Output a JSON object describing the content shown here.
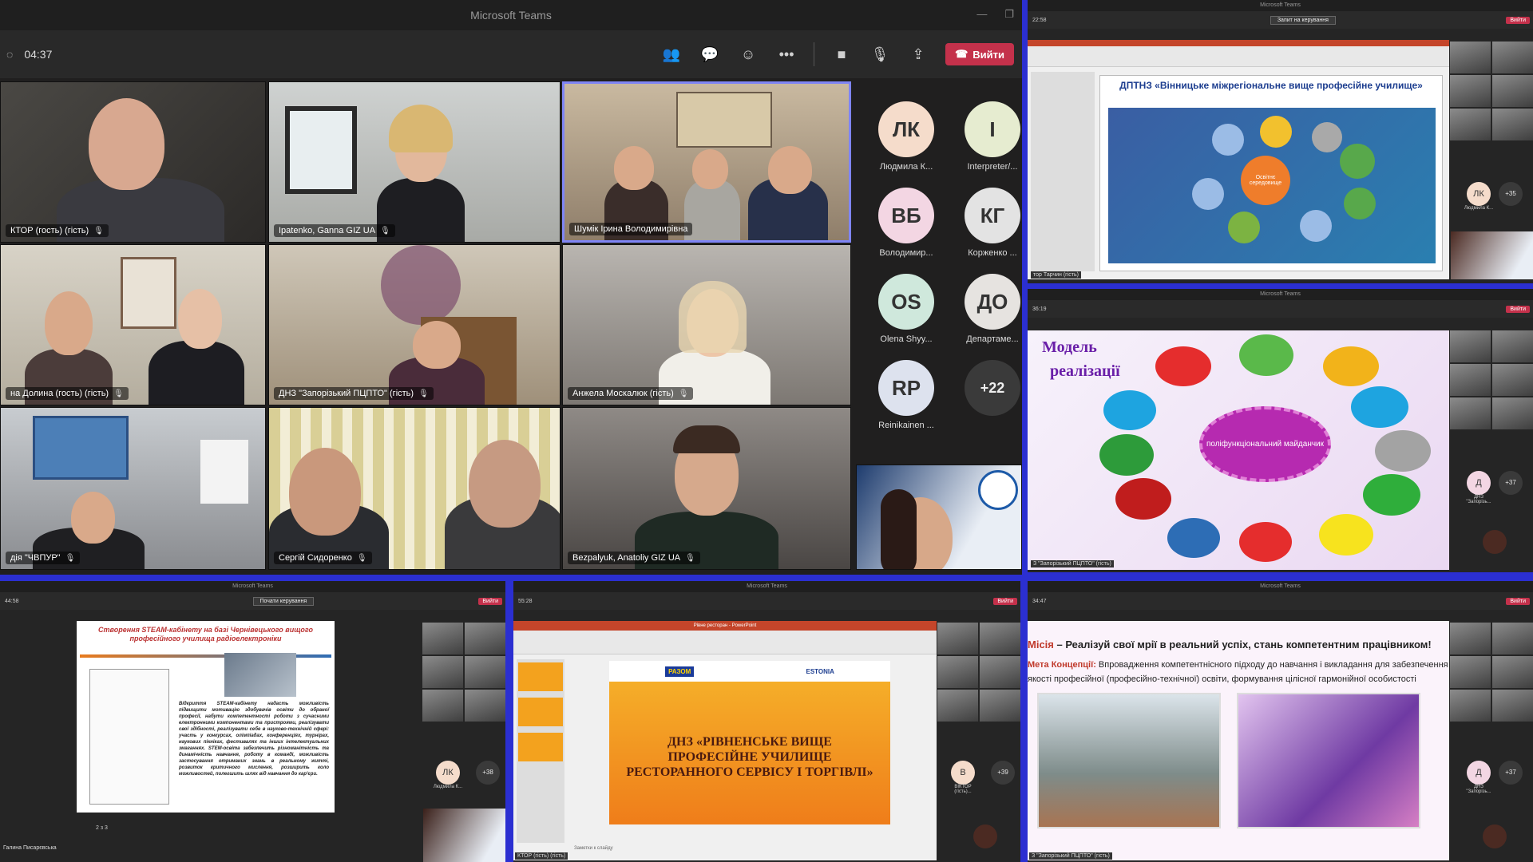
{
  "main": {
    "window_title": "Microsoft Teams",
    "timer": "04:37",
    "leave_label": "Вийти",
    "tiles": [
      {
        "name": "КТОР (гость) (гість)"
      },
      {
        "name": "Ipatenko, Ganna GIZ UA"
      },
      {
        "name": "Шумік Ірина Володимирівна"
      },
      {
        "name": "на Долина (гость) (гість)"
      },
      {
        "name": "ДНЗ \"Запорізький ПЦПТО\" (гість)"
      },
      {
        "name": "Анжела Москалюк (гість)"
      },
      {
        "name": "дія \"ЧВПУР\""
      },
      {
        "name": "Сергій Сидоренко"
      },
      {
        "name": "Bezpalyuk, Anatoliy GIZ UA"
      }
    ],
    "avatars": [
      {
        "initials": "ЛК",
        "name": "Людмила К...",
        "color": "#f5dccb"
      },
      {
        "initials": "І",
        "name": "Interpreter/...",
        "color": "#e6ecd0"
      },
      {
        "initials": "ВБ",
        "name": "Володимир...",
        "color": "#f3d6e3"
      },
      {
        "initials": "КГ",
        "name": "Корженко ...",
        "color": "#e3e3e3"
      },
      {
        "initials": "OS",
        "name": "Olena Shyy...",
        "color": "#cfe8dc"
      },
      {
        "initials": "ДО",
        "name": "Департаме...",
        "color": "#e6e3e0"
      },
      {
        "initials": "RP",
        "name": "Reinikainen ...",
        "color": "#dde2ee"
      }
    ],
    "overflow": "+22"
  },
  "p2": {
    "title": "Microsoft Teams",
    "timer": "22:58",
    "control_btn": "Запит на керування",
    "leave": "Вийти",
    "slide_title": "ДПТНЗ «Вінницьке міжрегіональне вище професійне училище»",
    "center": "Освітнє середовище",
    "avatar": "ЛК",
    "avatar_name": "Людмила К...",
    "overflow": "+35",
    "footer": "тор Тарчин (гість)"
  },
  "p3": {
    "title": "Microsoft Teams",
    "timer": "36:19",
    "leave": "Вийти",
    "slide_title_1": "Модель",
    "slide_title_2": "реалізації",
    "center": "поліфункціональний майданчик",
    "avatar": "Д",
    "avatar_name": "ДНЗ \"Запорізь...",
    "overflow": "+37",
    "footer": "З \"Запорізький ПЦПТО\" (гість)"
  },
  "p4": {
    "title": "Microsoft Teams",
    "timer": "44:58",
    "control_btn": "Почати керування",
    "leave": "Вийти",
    "slide_title": "Створення STEAM-кабінету на базі Чернівецького вищого професійного училища радіоелектроніки",
    "slide_text": "Відкриття STEAM-кабінету надасть можливість підвищити мотивацію здобувачів освіти до обраної професії, набути компетентності роботи з сучасними електронними компонентами та пристроями, реалізувати свої здібності, реалізувати себе в науково-технічній сфері: участь у конкурсах, олімпіадах, конференціях, турнірах, наукових пікніках, фестивалях та інших інтелектуальних змаганнях. STEM-освіта забезпечить різноманітність та динамічність навчання, роботу в команді, можливість застосування отриманих знань в реальному житті, розвиток критичного мислення, розширить коло можливостей, полегшить шлях від навчання до кар'єри.",
    "page": "2 з 3",
    "avatar": "ЛК",
    "avatar_name": "Людмила К...",
    "overflow": "+38",
    "footer": "Галина Писарєвська"
  },
  "p5": {
    "title": "Microsoft Teams",
    "timer": "55:28",
    "leave": "Вийти",
    "ppt_title": "Рівне ресторан - PowerPoint",
    "slide_title": "ДНЗ «РІВНЕНСЬКЕ ВИЩЕ ПРОФЕСІЙНЕ УЧИЛИЩЕ РЕСТОРАННОГО СЕРВІСУ І ТОРГІВЛІ»",
    "logo1": "РАЗОМ",
    "logo2": "ESTONIA",
    "notes": "Заметки к слайду",
    "avatar": "В",
    "avatar_name": "ВІКТОР (гість)...",
    "overflow": "+39",
    "footer": "КТОР (гість) (гість)"
  },
  "p6": {
    "title": "Microsoft Teams",
    "timer": "34:47",
    "leave": "Вийти",
    "mission_label": "Місія",
    "mission_text": " – Реалізуй свої мрії в реальний успіх, стань компетентним працівником!",
    "goal_label": "Мета Концепції:",
    "goal_text": " Впровадження компетентнісного підходу до навчання і викладання для забезпечення якості професійної (професійно-технічної) освіти, формування цілісної гармонійної особистості",
    "avatar": "Д",
    "avatar_name": "ДНЗ \"Запорізь...",
    "overflow": "+37",
    "footer": "З \"Запорізький ПЦПТО\" (гість)"
  }
}
